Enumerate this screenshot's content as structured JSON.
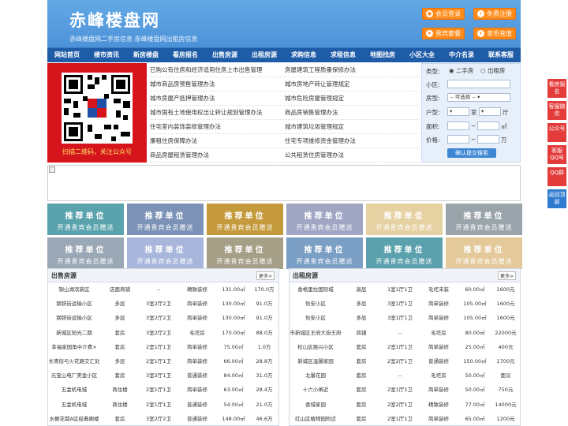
{
  "header": {
    "title": "赤峰楼盘网",
    "subtitle": "赤峰楼盘网二手房信息  赤峰楼盘网出租房信息",
    "buttons": [
      "会员登录",
      "免费注册",
      "贵宾套餐",
      "金币充值"
    ]
  },
  "nav": [
    "网站首页",
    "楼市资讯",
    "新房楼盘",
    "看房报名",
    "出售房源",
    "出租房源",
    "求购信息",
    "求租信息",
    "地图找房",
    "小区大全",
    "中介名录",
    "联系客服"
  ],
  "qr": {
    "caption": "扫描二维码，关注公众号"
  },
  "links": [
    [
      "已购公有住房和经济适用住房上市出售管理",
      "房屋建筑工程质量保修办法"
    ],
    [
      "城市商品房预售管理办法",
      "城市房地产转让管理规定"
    ],
    [
      "城市房屋产抵押管理办法",
      "城市危险房屋管理规定"
    ],
    [
      "城市国有土地使用权出让转让规划管理办法",
      "商品房销售管理办法"
    ],
    [
      "住宅室内装饰装修管理办法",
      "城市建筑垃圾管理规定"
    ],
    [
      "廉租住房保障办法",
      "住宅专项维修资金管理办法"
    ],
    [
      "商品房屋租赁管理办法",
      "公共租赁住房管理办法"
    ]
  ],
  "search": {
    "type_label": "类型:",
    "opt_sale": "二手房",
    "opt_rent": "出租房",
    "community_label": "小区:",
    "housetype_label": "房型:",
    "housetype_value": "-- 可选择 --",
    "layout_label": "户型:",
    "room_unit": "室",
    "hall_unit": "厅",
    "area_label": "面积:",
    "area_unit": "㎡",
    "price_label": "价格:",
    "price_unit": "万",
    "tilde": "~",
    "submit": "确认提交搜索"
  },
  "tile": {
    "line1": "推荐单位",
    "line2": "开通贵宾会员赠送"
  },
  "tile_colors": [
    "#5aa3ad",
    "#7c93b7",
    "#c49a3c",
    "#a0a6c4",
    "#e6d1a3",
    "#9aa5ab",
    "#9aa7b5",
    "#a9b6dc",
    "#a59f88",
    "#7b9ec4",
    "#5ba1ad",
    "#e4c99a"
  ],
  "sale": {
    "title": "出售房源",
    "more": "更多>",
    "rows": [
      [
        "锦山湖滨新区",
        "店面商铺",
        "--",
        "精致装修",
        "131.00㎡",
        "170.0万"
      ],
      [
        "钢铁街运输小区",
        "多层",
        "3室2厅2卫",
        "简单装修",
        "130.00㎡",
        "91.0万"
      ],
      [
        "钢铁街运输小区",
        "多层",
        "3室2厅2卫",
        "简单装修",
        "130.00㎡",
        "91.0万"
      ],
      [
        "新城区阳光二期",
        "套房",
        "3室2厅2卫",
        "毛坯房",
        "170.00㎡",
        "88.0万"
      ],
      [
        "幸福家园角中介费×",
        "套房",
        "2室1厅1卫",
        "简单装修",
        "75.00㎡",
        "1.0万"
      ],
      [
        "长青街与火花路交汇处",
        "多层",
        "2室1厅1卫",
        "简单装修",
        "66.00㎡",
        "28.8万"
      ],
      [
        "元宝山电厂美金小区",
        "套房",
        "3室2厅1卫",
        "普通装修",
        "84.00㎡",
        "31.0万"
      ],
      [
        "五金机电城",
        "商住楼",
        "2室1厅1卫",
        "简单装修",
        "63.00㎡",
        "28.4万"
      ],
      [
        "五金机电城",
        "商住楼",
        "2室1厅1卫",
        "普通装修",
        "54.00㎡",
        "21.0万"
      ],
      [
        "水榭花都A区经典阁楼",
        "套房",
        "3室2厅2卫",
        "普通装修",
        "148.00㎡",
        "46.6万"
      ]
    ]
  },
  "rent": {
    "title": "出租房源",
    "more": "更多>",
    "rows": [
      [
        "香格里拉国际城",
        "高层",
        "1室1厅1卫",
        "毛坯未装",
        "60.00㎡",
        "1600元"
      ],
      [
        "怡安小区",
        "多层",
        "3室1厅1卫",
        "简单装修",
        "105.00㎡",
        "1600元"
      ],
      [
        "怡安小区",
        "多层",
        "3室1厅1卫",
        "简单装修",
        "105.00㎡",
        "1600元"
      ],
      [
        "市新城区王府大街王府",
        "商铺",
        "--",
        "毛坯房",
        "80.00㎡",
        "22000元"
      ],
      [
        "松山区振兴小区",
        "套房",
        "2室1厅1卫",
        "简单装修",
        "25.00㎡",
        "400元"
      ],
      [
        "新城区温馨家园",
        "套房",
        "2室2厅1卫",
        "普通装修",
        "150.00㎡",
        "1700元"
      ],
      [
        "北馨花园",
        "套房",
        "--",
        "毛坯房",
        "50.00㎡",
        "面议"
      ],
      [
        "十六小闸近",
        "套房",
        "2室1厅1卫",
        "简单装修",
        "50.00㎡",
        "750元"
      ],
      [
        "香城家园",
        "套房",
        "2室2厅1卫",
        "精致装修",
        "77.00㎡",
        "14000元"
      ],
      [
        "红山区植物园附近",
        "套房",
        "2室1厅1卫",
        "简单装修",
        "65.00㎡",
        "1200元"
      ]
    ]
  },
  "side_tabs": [
    "看房报名",
    "客服微信",
    "公众号",
    "客服QQ号",
    "QQ群",
    "返回顶部"
  ]
}
